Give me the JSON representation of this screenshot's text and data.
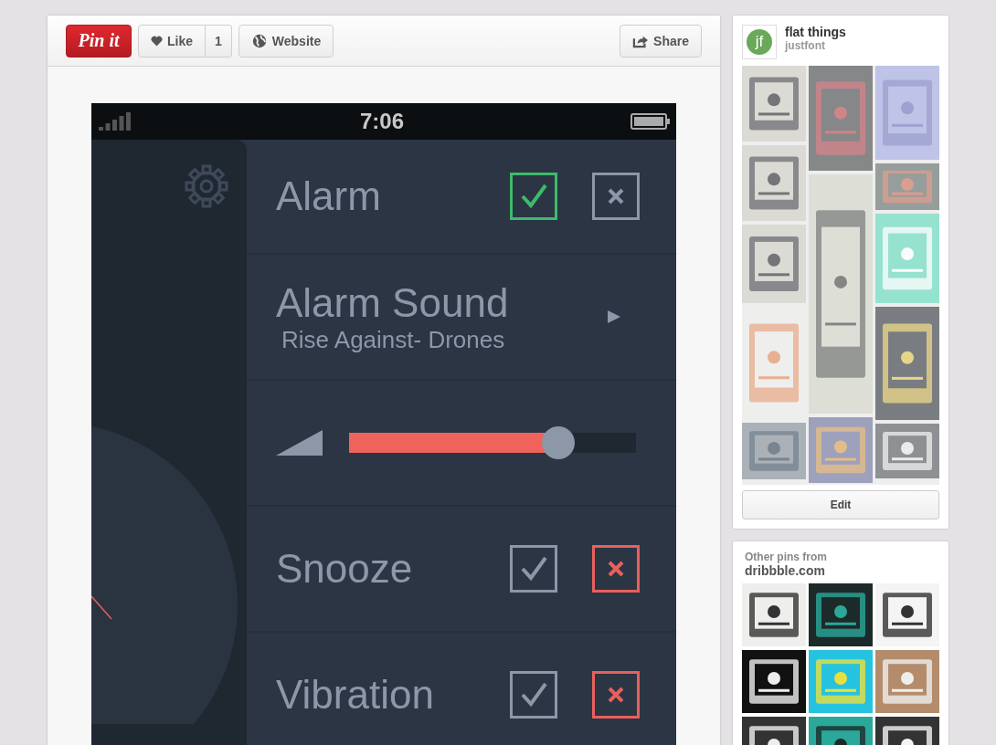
{
  "toolbar": {
    "pin_button": "Pin it",
    "like_button": "Like",
    "like_count": "1",
    "website_button": "Website",
    "share_button": "Share"
  },
  "pin_image": {
    "status_time": "7:06",
    "rows": [
      {
        "kind": "toggle",
        "label": "Alarm",
        "on": true
      },
      {
        "kind": "track",
        "label": "Alarm Sound",
        "sublabel": "Rise Against- Drones"
      },
      {
        "kind": "volume",
        "level": 0.73
      },
      {
        "kind": "toggle",
        "label": "Snooze",
        "on": false
      },
      {
        "kind": "toggle",
        "label": "Vibration",
        "on": false
      }
    ]
  },
  "board": {
    "avatar": "jf",
    "title": "flat things",
    "owner": "justfont",
    "edit_button": "Edit"
  },
  "other_pins": {
    "heading": "Other pins from",
    "source": "dribbble.com"
  }
}
